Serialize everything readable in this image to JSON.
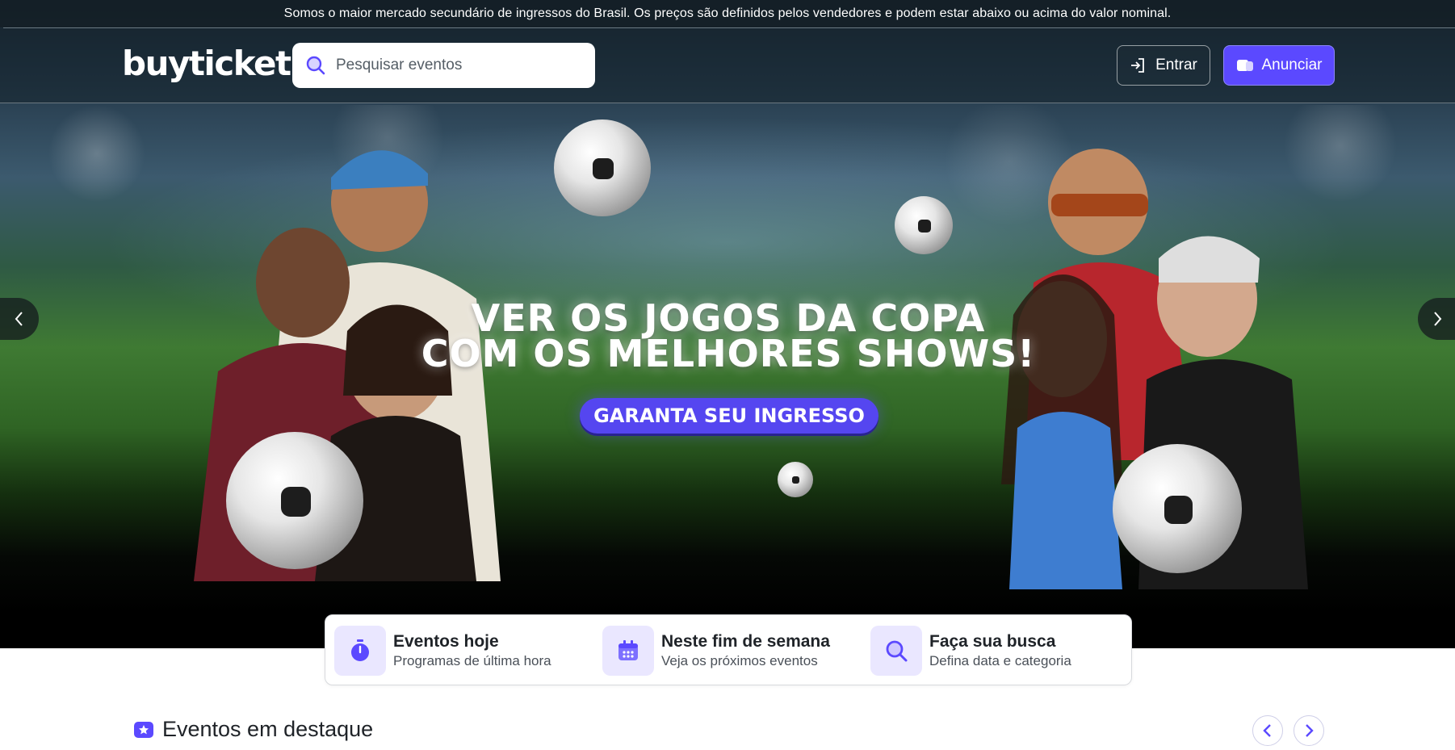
{
  "notice": {
    "text": "Somos o maior mercado secundário de ingressos do Brasil. Os preços são definidos pelos vendedores e podem estar abaixo ou acima do valor nominal."
  },
  "header": {
    "logo": "buyticket",
    "search": {
      "placeholder": "Pesquisar eventos",
      "value": ""
    },
    "login_label": "Entrar",
    "announce_label": "Anunciar"
  },
  "hero": {
    "title_line1": "VER OS JOGOS DA COPA",
    "title_line2": "COM OS MELHORES SHOWS!",
    "cta_label": "GARANTA SEU INGRESSO"
  },
  "quick_links": [
    {
      "title": "Eventos hoje",
      "subtitle": "Programas de última hora",
      "icon": "stopwatch-icon"
    },
    {
      "title": "Neste fim de semana",
      "subtitle": "Veja os próximos eventos",
      "icon": "calendar-icon"
    },
    {
      "title": "Faça sua busca",
      "subtitle": "Defina data e categoria",
      "icon": "search-icon"
    }
  ],
  "featured": {
    "title": "Eventos em destaque",
    "icon": "star-ticket-icon"
  },
  "colors": {
    "accent": "#5b49ff",
    "accent_light": "#eae7ff",
    "text_dark": "#1f2328"
  }
}
